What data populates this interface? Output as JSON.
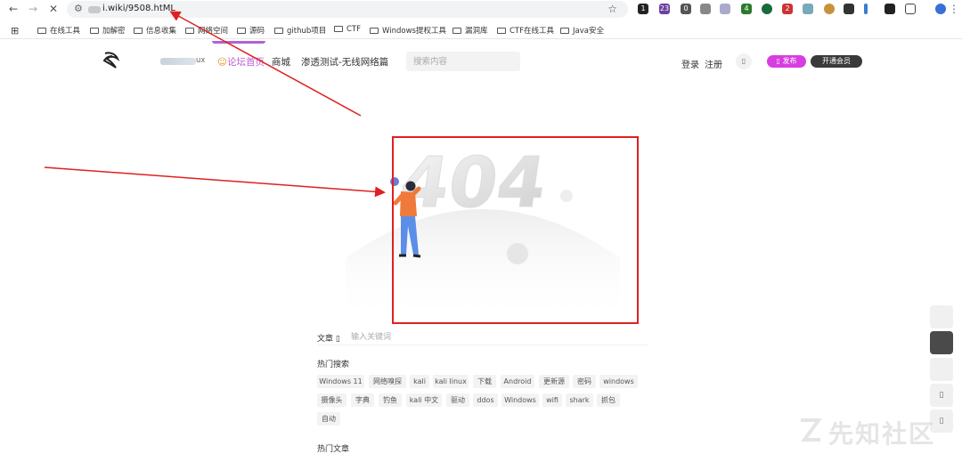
{
  "browser": {
    "url": "i.wiki/9508.htML",
    "extension_badges": [
      "1",
      "23",
      "0",
      "4",
      "2"
    ]
  },
  "bookmarks": [
    "在线工具",
    "加解密",
    "信息收集",
    "网络空间",
    "源码",
    "github项目",
    "CTF",
    "Windows提权工具",
    "漏洞库",
    "CTF在线工具",
    "Java安全"
  ],
  "site": {
    "user_suffix": "ux",
    "nav": [
      "论坛首页",
      "商城",
      "渗透测试-无线网络篇"
    ],
    "search_placeholder": "搜索内容",
    "login": "登录",
    "register": "注册",
    "publish": "发布",
    "member": "开通会员"
  },
  "error": {
    "code": "404"
  },
  "search_area": {
    "label": "文章",
    "placeholder": "输入关键词"
  },
  "hot_search": {
    "title": "热门搜索",
    "tags": [
      "Windows 11",
      "网络嗅探",
      "kali",
      "kali linux",
      "下载",
      "Android",
      "更新源",
      "密码",
      "windows",
      "摄像头",
      "字典",
      "钓鱼",
      "kali 中文",
      "驱动",
      "ddos",
      "Windows",
      "wifi",
      "shark",
      "抓包",
      "自动"
    ]
  },
  "hot_articles": {
    "title": "热门文章"
  },
  "watermark": "先知社区",
  "colors": {
    "annotation": "#e02020",
    "publish": "#d73ee0",
    "active_nav": "#c25bd6"
  }
}
